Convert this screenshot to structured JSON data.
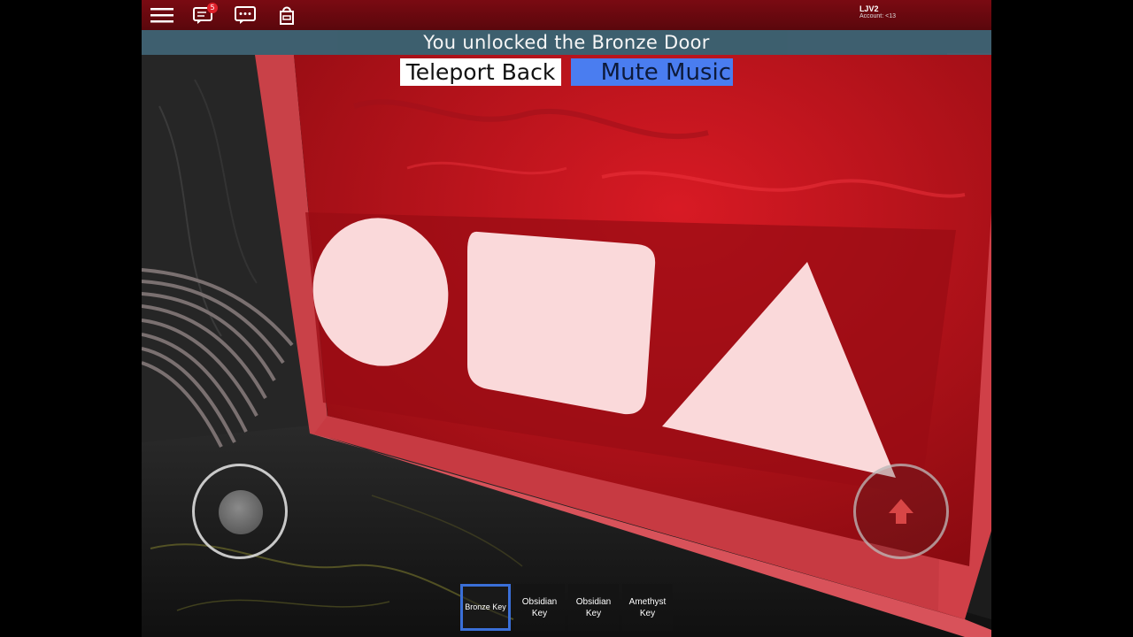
{
  "topbar": {
    "icons": [
      "menu-icon",
      "chat-notification-icon",
      "chat-icon",
      "backpack-icon"
    ],
    "notification_count": "5",
    "account_name": "LJV2",
    "account_info": "Account: <13"
  },
  "banner": {
    "message": "You unlocked the Bronze Door"
  },
  "buttons": {
    "teleport_label": "Teleport Back",
    "mute_label": "Mute Music"
  },
  "hotbar": {
    "slots": [
      {
        "label": "Bronze Key",
        "selected": true
      },
      {
        "label": "Obsidian Key",
        "selected": false
      },
      {
        "label": "Obsidian Key",
        "selected": false
      },
      {
        "label": "Amethyst Key",
        "selected": false
      }
    ]
  },
  "colors": {
    "topbar": "#6a0810",
    "banner": "#3f6272",
    "mute_button": "#4a7df0",
    "wall": "#c81e28",
    "shapes": "#fad9da"
  }
}
